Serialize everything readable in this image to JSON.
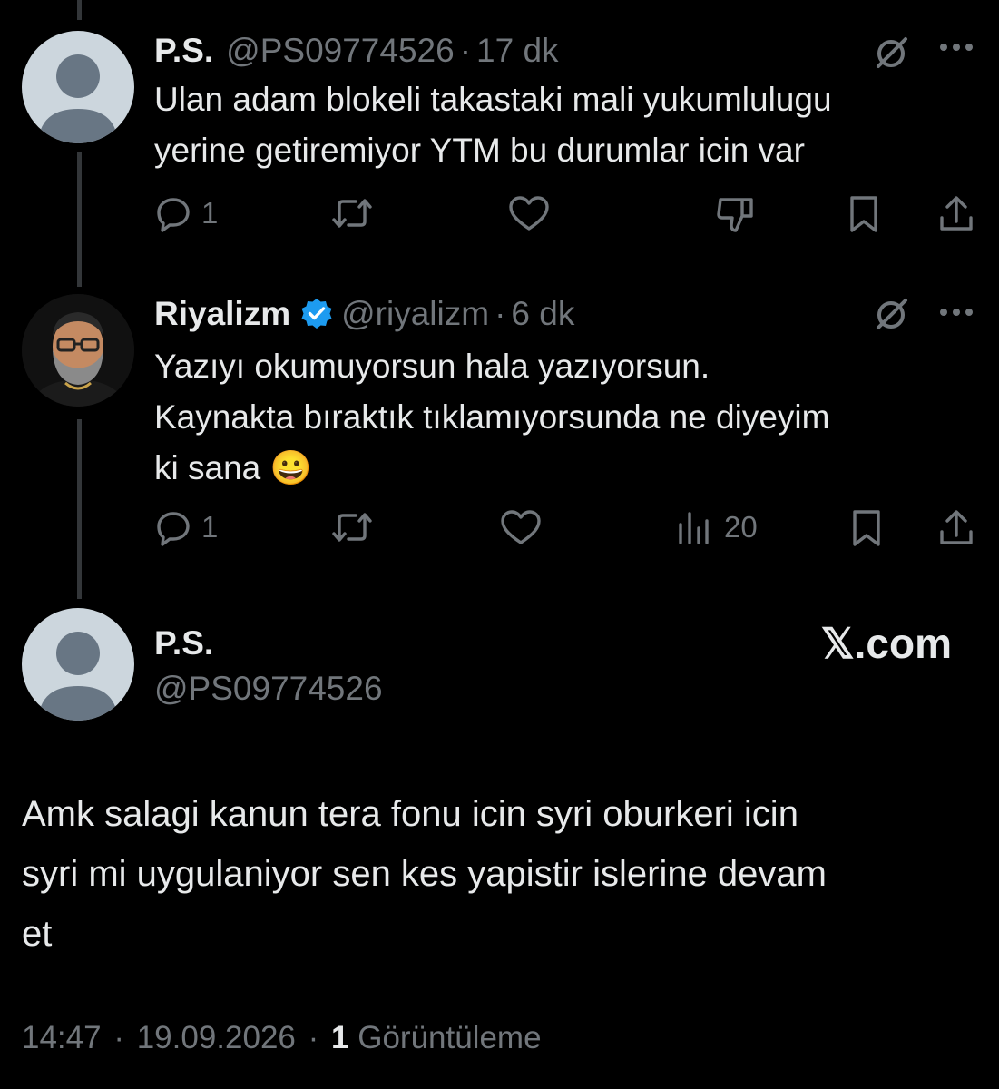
{
  "colors": {
    "background": "#000000",
    "text": "#e7e9ea",
    "muted": "#71767b",
    "verified": "#1d9bf0",
    "thread_line": "#333639"
  },
  "thread": [
    {
      "name": "P.S.",
      "handle": "@PS09774526",
      "separator": "·",
      "time": "17 dk",
      "text_lines": [
        "Ulan adam blokeli takastaki mali yukumlulugu",
        "yerine getiremiyor YTM bu durumlar icin var"
      ],
      "reply_count": "1",
      "icons": [
        "grok-icon",
        "more-icon",
        "reply-icon",
        "retweet-icon",
        "like-icon",
        "downvote-icon",
        "bookmark-icon",
        "share-icon"
      ]
    },
    {
      "name": "Riyalizm",
      "verified": true,
      "handle": "@riyalizm",
      "separator": "·",
      "time": "6 dk",
      "text_lines": [
        "Yazıyı okumuyorsun hala yazıyorsun.",
        "Kaynakta bıraktık tıklamıyorsunda ne diyeyim",
        "ki sana 😀"
      ],
      "reply_count": "1",
      "view_count": "20",
      "icons": [
        "grok-icon",
        "more-icon",
        "reply-icon",
        "retweet-icon",
        "like-icon",
        "analytics-icon",
        "bookmark-icon",
        "share-icon"
      ]
    }
  ],
  "main": {
    "name": "P.S.",
    "handle": "@PS09774526",
    "watermark": "𝕏.com",
    "text_lines": [
      "Amk salagi kanun tera fonu icin syri oburkeri icin",
      "syri mi uygulaniyor sen kes yapistir islerine devam",
      "et"
    ],
    "time": "14:47",
    "separator": "·",
    "date": "19.09.2026",
    "separator2": "·",
    "view_count": "1",
    "view_label": "Görüntüleme"
  }
}
